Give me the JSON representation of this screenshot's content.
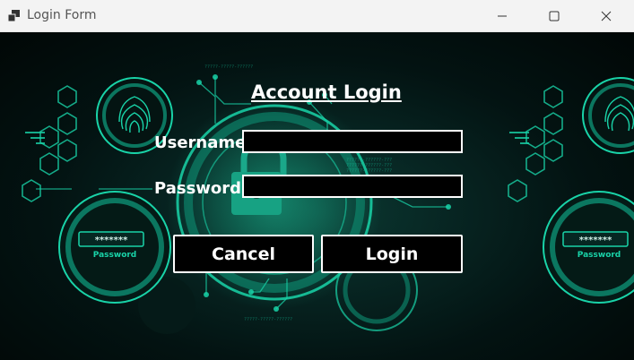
{
  "window": {
    "title": "Login Form"
  },
  "form": {
    "heading": "Account Login",
    "username_label": "Username",
    "username_value": "",
    "password_label": "Password",
    "password_value": "",
    "cancel_label": "Cancel",
    "login_label": "Login"
  },
  "background": {
    "password_badge_text": "Password",
    "password_mask": "*******"
  },
  "colors": {
    "accent": "#19d3a8",
    "titlebar": "#f3f3f3",
    "background": "#031312"
  }
}
